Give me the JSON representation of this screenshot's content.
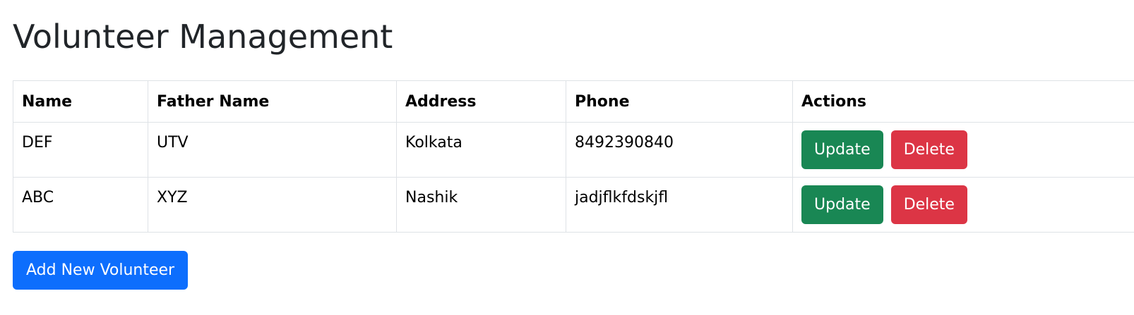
{
  "page": {
    "title": "Volunteer Management"
  },
  "table": {
    "headers": {
      "name": "Name",
      "father_name": "Father Name",
      "address": "Address",
      "phone": "Phone",
      "actions": "Actions"
    },
    "rows": [
      {
        "name": "DEF",
        "father_name": "UTV",
        "address": "Kolkata",
        "phone": "8492390840"
      },
      {
        "name": "ABC",
        "father_name": "XYZ",
        "address": "Nashik",
        "phone": "jadjflkfdskjfl"
      }
    ]
  },
  "buttons": {
    "update_label": "Update",
    "delete_label": "Delete",
    "add_label": "Add New Volunteer"
  },
  "colors": {
    "update": "#198754",
    "delete": "#dc3545",
    "add": "#0d6efd"
  }
}
